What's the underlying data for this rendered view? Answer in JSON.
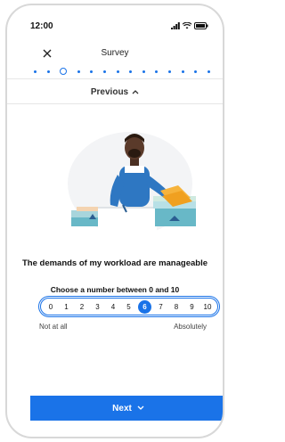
{
  "status": {
    "time": "12:00"
  },
  "header": {
    "title": "Survey"
  },
  "progress": {
    "total_steps": 14,
    "current_step": 3
  },
  "nav": {
    "previous_label": "Previous",
    "next_label": "Next"
  },
  "question": {
    "text": "The demands of my workload are manageable"
  },
  "scale": {
    "prompt": "Choose a number between 0 and 10",
    "options": [
      "0",
      "1",
      "2",
      "3",
      "4",
      "5",
      "6",
      "7",
      "8",
      "9",
      "10"
    ],
    "selected": "6",
    "low_anchor": "Not at all",
    "high_anchor": "Absolutely"
  },
  "colors": {
    "accent": "#1a73e8",
    "border": "#d8d8d8"
  }
}
